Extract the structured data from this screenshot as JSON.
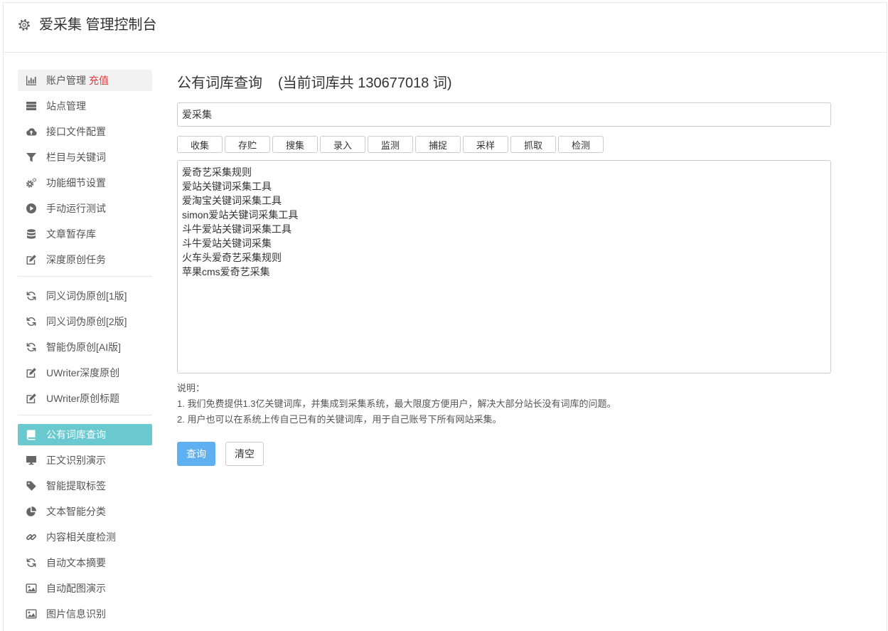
{
  "header": {
    "title": "爱采集 管理控制台",
    "icon": "gear-icon"
  },
  "sidebar": {
    "items": [
      {
        "label": "账户管理",
        "badge": "充值",
        "icon": "bar-chart-icon"
      },
      {
        "label": "站点管理",
        "icon": "server-icon"
      },
      {
        "label": "接口文件配置",
        "icon": "cloud-upload-icon"
      },
      {
        "label": "栏目与关键词",
        "icon": "filter-icon"
      },
      {
        "label": "功能细节设置",
        "icon": "gears-icon"
      },
      {
        "label": "手动运行测试",
        "icon": "play-circle-icon"
      },
      {
        "label": "文章暂存库",
        "icon": "database-icon"
      },
      {
        "label": "深度原创任务",
        "icon": "edit-icon"
      },
      {
        "label": "同义词伪原创[1版]",
        "icon": "refresh-icon"
      },
      {
        "label": "同义词伪原创[2版]",
        "icon": "refresh-icon"
      },
      {
        "label": "智能伪原创[AI版]",
        "icon": "refresh-icon"
      },
      {
        "label": "UWriter深度原创",
        "icon": "edit-icon"
      },
      {
        "label": "UWriter原创标题",
        "icon": "edit-icon"
      },
      {
        "label": "公有词库查询",
        "icon": "book-icon",
        "active": true
      },
      {
        "label": "正文识别演示",
        "icon": "desktop-icon"
      },
      {
        "label": "智能提取标签",
        "icon": "tag-icon"
      },
      {
        "label": "文本智能分类",
        "icon": "pie-chart-icon"
      },
      {
        "label": "内容相关度检测",
        "icon": "link-icon"
      },
      {
        "label": "自动文本摘要",
        "icon": "refresh-icon"
      },
      {
        "label": "自动配图演示",
        "icon": "image-icon"
      },
      {
        "label": "图片信息识别",
        "icon": "image-icon"
      }
    ]
  },
  "main": {
    "title": "公有词库查询",
    "count_text": "(当前词库共 130677018 词)",
    "search": {
      "value": "爱采集"
    },
    "verbs": [
      "收集",
      "存贮",
      "搜集",
      "录入",
      "监测",
      "捕捉",
      "采样",
      "抓取",
      "检测"
    ],
    "results": "爱奇艺采集规则\n爱站关键词采集工具\n爱淘宝关键词采集工具\nsimon爱站关键词采集工具\n斗牛爱站关键词采集工具\n斗牛爱站关键词采集\n火车头爱奇艺采集规则\n苹果cms爱奇艺采集",
    "notes": {
      "heading": "说明：",
      "lines": [
        "1. 我们免费提供1.3亿关键词库，并集成到采集系统，最大限度方便用户，解决大部分站长没有词库的问题。",
        "2. 用户也可以在系统上传自己已有的关键词库，用于自己账号下所有网站采集。"
      ]
    },
    "query_label": "查询",
    "clear_label": "清空"
  },
  "colors": {
    "accent": "#6ac9cf",
    "primary_button": "#5eb0f0",
    "badge": "#e4393c",
    "highlight_bg": "#f2f2f2"
  }
}
